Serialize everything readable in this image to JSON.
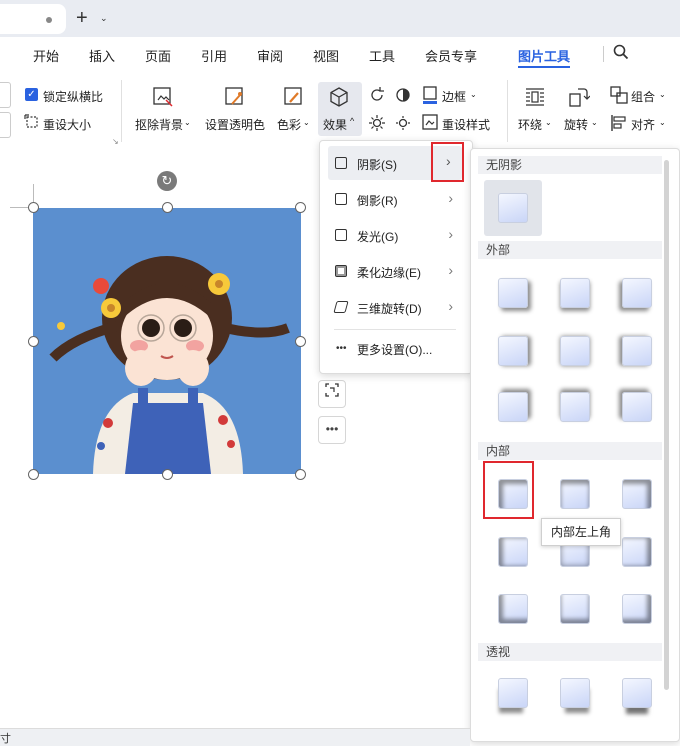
{
  "tabbar": {
    "new_tab_symbol": "+",
    "tab_dropdown": "⌄"
  },
  "menu": {
    "items": [
      "开始",
      "插入",
      "页面",
      "引用",
      "审阅",
      "视图",
      "工具",
      "会员专享",
      "图片工具"
    ],
    "active": "图片工具"
  },
  "ribbon": {
    "lock_ratio": "锁定纵横比",
    "reset_size": "重设大小",
    "remove_bg": "抠除背景",
    "set_transparent": "设置透明色",
    "color": "色彩",
    "effect": "效果",
    "border": "边框",
    "reset_style": "重设样式",
    "wrap": "环绕",
    "rotate": "旋转",
    "group": "组合",
    "align": "对齐"
  },
  "effect_menu": {
    "items": [
      {
        "label": "阴影(S)"
      },
      {
        "label": "倒影(R)"
      },
      {
        "label": "发光(G)"
      },
      {
        "label": "柔化边缘(E)"
      },
      {
        "label": "三维旋转(D)"
      }
    ],
    "more": "更多设置(O)..."
  },
  "shadow_panel": {
    "sections": {
      "none": "无阴影",
      "outer": "外部",
      "inner": "内部",
      "perspective": "透视"
    },
    "tooltip": "内部左上角"
  },
  "status": {
    "text": "寸"
  },
  "colors": {
    "accent": "#2a62e0",
    "highlight_red": "#e0282e",
    "photo_bg": "#5b8fcf"
  }
}
